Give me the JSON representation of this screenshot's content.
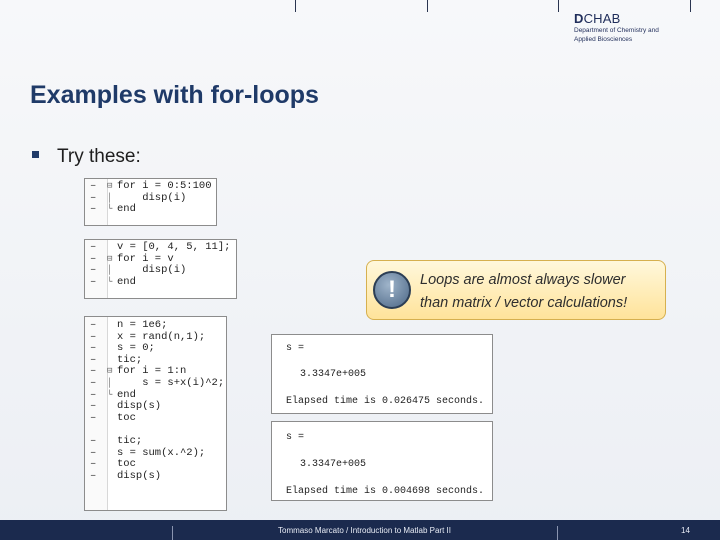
{
  "logo": {
    "brand_bold": "D",
    "brand_rest": "CHAB",
    "line1": "Department of Chemistry and",
    "line2": "Applied Biosciences"
  },
  "slide": {
    "title": "Examples with for-loops",
    "bullet": "Try these:"
  },
  "code_blocks": [
    {
      "lines": [
        "for i = 0:5:100",
        "    disp(i)",
        "end"
      ]
    },
    {
      "lines": [
        "v = [0, 4, 5, 11];",
        "for i = v",
        "    disp(i)",
        "end"
      ]
    },
    {
      "lines": [
        "n = 1e6;",
        "x = rand(n,1);",
        "s = 0;",
        "tic;",
        "for i = 1:n",
        "    s = s+x(i)^2;",
        "end",
        "disp(s)",
        "toc",
        "",
        "tic;",
        "s = sum(x.^2);",
        "toc",
        "disp(s)"
      ]
    }
  ],
  "outputs": [
    {
      "l1": "s =",
      "l2": "3.3347e+005",
      "l3": "Elapsed time is 0.026475 seconds."
    },
    {
      "l1": "s =",
      "l2": "3.3347e+005",
      "l3": "Elapsed time is 0.004698 seconds."
    }
  ],
  "callout": {
    "line1": "Loops are almost always slower",
    "line2": "than matrix / vector calculations!",
    "icon": "exclamation-icon"
  },
  "footer": {
    "text": "Tommaso Marcato / Introduction to Matlab Part II",
    "page": "14"
  }
}
